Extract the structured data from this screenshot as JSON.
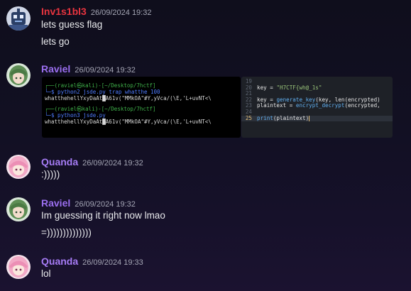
{
  "colors": {
    "inv": "#e8343f",
    "raviel": "#9b6ff0",
    "quanda": "#a67cf5"
  },
  "messages": [
    {
      "user": "Inv1s1bl3",
      "timestamp": "26/09/2024 19:32",
      "lines": [
        "lets guess flag",
        "lets go"
      ]
    },
    {
      "user": "Raviel",
      "timestamp": "26/09/2024 19:32"
    },
    {
      "user": "Quanda",
      "timestamp": "26/09/2024 19:32",
      "lines": [
        ":)))))"
      ]
    },
    {
      "user": "Raviel",
      "timestamp": "26/09/2024 19:32",
      "lines": [
        "Im guessing it right now lmao",
        "=))))))))))))))"
      ]
    },
    {
      "user": "Quanda",
      "timestamp": "26/09/2024 19:33",
      "lines": [
        "lol"
      ]
    }
  ],
  "terminal": {
    "block1_prompt": "┌──(raviel㉿kali)-[~/Desktop/7hctf]",
    "block1_cmd": "└─$ python2 jsde.py trap whatthe 100",
    "block1_out": "whatthehellYxyDaAt█A61v(\"MMkOA\"#Y,yVca/(\\E,'L+uvNT<\\",
    "block2_prompt": "┌──(raviel㉿kali)-[~/Desktop/7hctf]",
    "block2_cmd": "└─$ python3 jsde.py",
    "block2_out": "whatthehellYxyDaAt█A61v(\"MMkOA\"#Y,yVca/(\\E,'L+uvNT<\\"
  },
  "code": {
    "lines": [
      {
        "n": "19",
        "t": ""
      },
      {
        "n": "20",
        "t": "key = ",
        "s": "\"H7CTF{wh@_1s\""
      },
      {
        "n": "21",
        "t": ""
      },
      {
        "n": "22",
        "t": "key = ",
        "f": "generate_key",
        "r": "(key, len(encrypted)"
      },
      {
        "n": "23",
        "t": "plaintext = ",
        "f": "encrypt_decrypt",
        "r": "(encrypted,"
      },
      {
        "n": "24",
        "t": ""
      },
      {
        "n": "25",
        "f": "print",
        "r": "(plaintext)"
      }
    ]
  }
}
